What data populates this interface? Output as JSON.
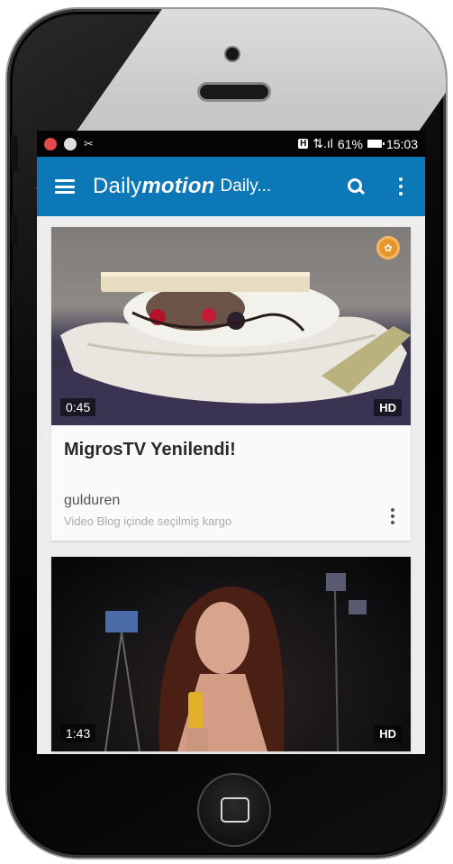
{
  "statusbar": {
    "hd_tag": "H",
    "signal": "⇅.ıl",
    "battery": "61%",
    "time": "15:03",
    "left_symbol": "✂"
  },
  "appbar": {
    "brand_a": "Daily",
    "brand_b": "motion",
    "channel": "Daily...",
    "color": "#0d78b8"
  },
  "feed": [
    {
      "duration": "0:45",
      "quality": "HD",
      "title": "MigrosTV Yenilendi!",
      "owner": "gulduren",
      "subtitle": "Video Blog içinde seçilmiş kargo"
    },
    {
      "duration": "1:43",
      "quality": "HD"
    }
  ]
}
